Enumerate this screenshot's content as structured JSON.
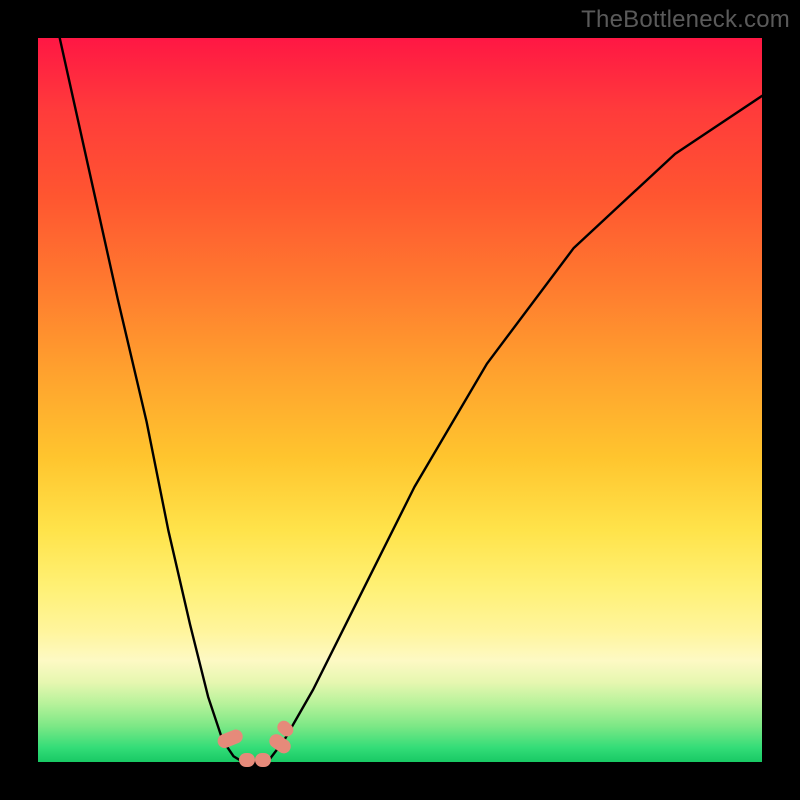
{
  "watermark": "TheBottleneck.com",
  "chart_data": {
    "type": "line",
    "title": "",
    "xlabel": "",
    "ylabel": "",
    "xlim": [
      0,
      100
    ],
    "ylim": [
      0,
      100
    ],
    "grid": false,
    "legend": false,
    "annotations": [],
    "series": [
      {
        "name": "left-branch",
        "x": [
          3,
          7,
          11,
          15,
          18,
          21,
          23.5,
          25.5,
          27,
          28.3
        ],
        "y": [
          100,
          82,
          64,
          47,
          32,
          19,
          9,
          3,
          0.8,
          0
        ]
      },
      {
        "name": "floor",
        "x": [
          28.3,
          30.0,
          31.7
        ],
        "y": [
          0,
          0,
          0
        ]
      },
      {
        "name": "right-branch",
        "x": [
          31.7,
          34,
          38,
          44,
          52,
          62,
          74,
          88,
          100
        ],
        "y": [
          0,
          3,
          10,
          22,
          38,
          55,
          71,
          84,
          92
        ]
      }
    ],
    "markers": [
      {
        "x": 26.5,
        "y": 3.2,
        "w": 2.0,
        "h": 3.6,
        "angle": 68
      },
      {
        "x": 28.9,
        "y": 0.3,
        "w": 2.2,
        "h": 2.0,
        "angle": 0
      },
      {
        "x": 31.1,
        "y": 0.3,
        "w": 2.2,
        "h": 2.0,
        "angle": 0
      },
      {
        "x": 33.4,
        "y": 2.6,
        "w": 2.0,
        "h": 3.2,
        "angle": -55
      },
      {
        "x": 34.2,
        "y": 4.6,
        "w": 1.8,
        "h": 2.4,
        "angle": -48
      }
    ],
    "colors": {
      "curve": "#000000",
      "marker": "#e68a7a",
      "band_green": "#18c964",
      "band_yellow": "#ffe34a",
      "band_red": "#ff1744"
    }
  }
}
